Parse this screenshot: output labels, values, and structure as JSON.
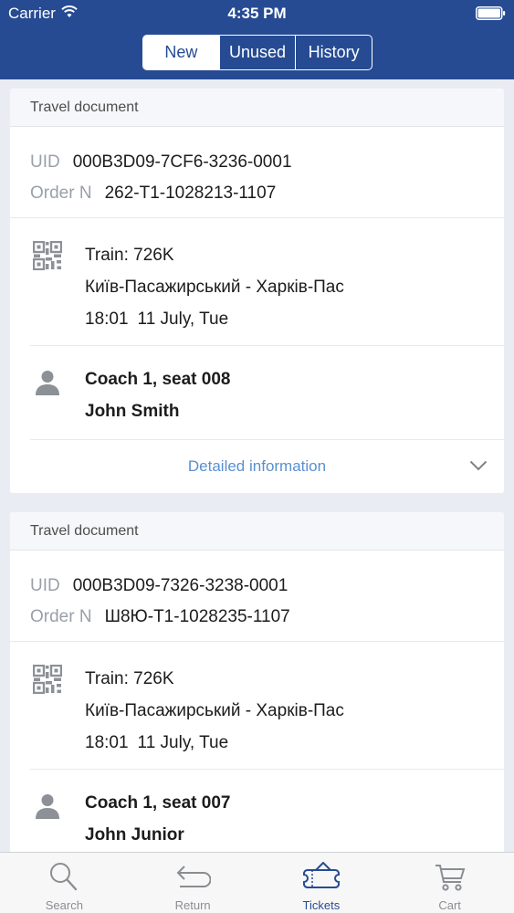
{
  "status_bar": {
    "carrier": "Carrier",
    "time": "4:35 PM"
  },
  "segments": [
    {
      "label": "New",
      "active": true
    },
    {
      "label": "Unused",
      "active": false
    },
    {
      "label": "History",
      "active": false
    }
  ],
  "tickets": [
    {
      "header": "Travel document",
      "uid_label": "UID",
      "uid": "000B3D09-7CF6-3236-0001",
      "order_label": "Order N",
      "order": "262-T1-1028213-1107",
      "train": "Train: 726K",
      "route": "Київ-Пасажирський - Харків-Пас",
      "time": "18:01",
      "date": "11 July, Tue",
      "seat": "Coach 1, seat 008",
      "passenger": "John Smith",
      "detail_link": "Detailed information"
    },
    {
      "header": "Travel document",
      "uid_label": "UID",
      "uid": "000B3D09-7326-3238-0001",
      "order_label": "Order N",
      "order": "Ш8Ю-T1-1028235-1107",
      "train": "Train: 726K",
      "route": "Київ-Пасажирський - Харків-Пас",
      "time": "18:01",
      "date": "11 July, Tue",
      "seat": "Coach 1, seat 007",
      "passenger": "John Junior"
    }
  ],
  "tabbar": [
    {
      "label": "Search",
      "icon": "search-icon",
      "active": false
    },
    {
      "label": "Return",
      "icon": "return-icon",
      "active": false
    },
    {
      "label": "Tickets",
      "icon": "ticket-icon",
      "active": true
    },
    {
      "label": "Cart",
      "icon": "cart-icon",
      "active": false
    }
  ],
  "colors": {
    "header_bg": "#264b93",
    "link": "#5a8fd0",
    "active_tab": "#264b93",
    "page_bg": "#e9edf3"
  }
}
